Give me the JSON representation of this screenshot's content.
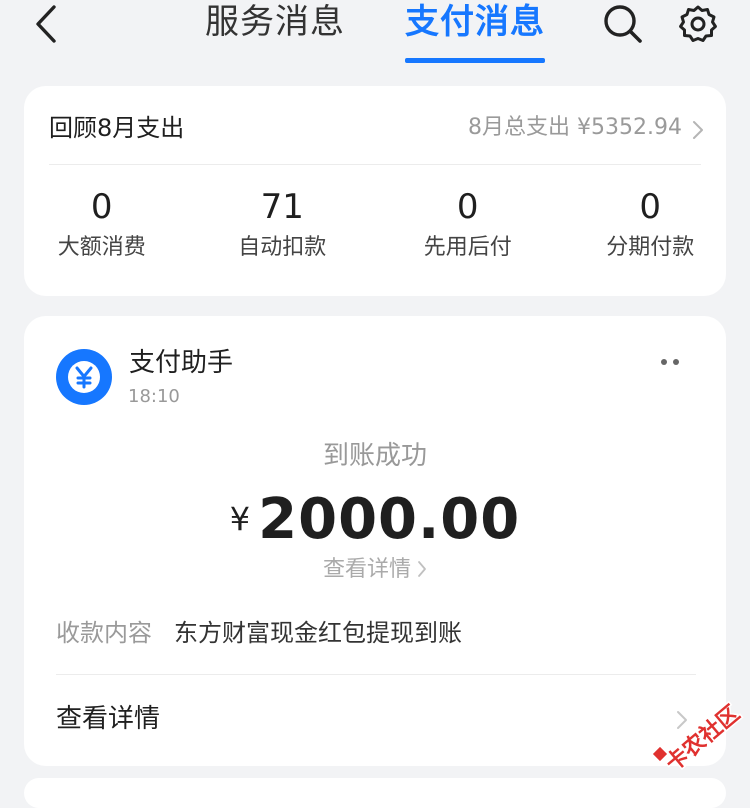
{
  "nav": {
    "tabs": [
      {
        "label": "服务消息",
        "active": false
      },
      {
        "label": "支付消息",
        "active": true
      }
    ],
    "icons": {
      "back": "chevron-left-icon",
      "search": "search-icon",
      "settings": "gear-icon"
    }
  },
  "summary": {
    "title": "回顾8月支出",
    "total_text": "8月总支出 ¥5352.94",
    "stats": [
      {
        "value": "0",
        "label": "大额消费"
      },
      {
        "value": "71",
        "label": "自动扣款"
      },
      {
        "value": "0",
        "label": "先用后付"
      },
      {
        "value": "0",
        "label": "分期付款"
      }
    ]
  },
  "message": {
    "sender": "支付助手",
    "sender_icon": "yen-icon",
    "time": "18:10",
    "status": "到账成功",
    "currency": "¥",
    "amount": "2000.00",
    "detail_link": "查看详情",
    "content_label": "收款内容",
    "content_value": "东方财富现金红包提现到账",
    "view_details": "查看详情"
  },
  "watermark": {
    "text": "卡农社区"
  },
  "colors": {
    "accent": "#1677ff",
    "background": "#f2f3f5",
    "card": "#ffffff",
    "muted_text": "#999999",
    "watermark_red": "#e0312f"
  }
}
